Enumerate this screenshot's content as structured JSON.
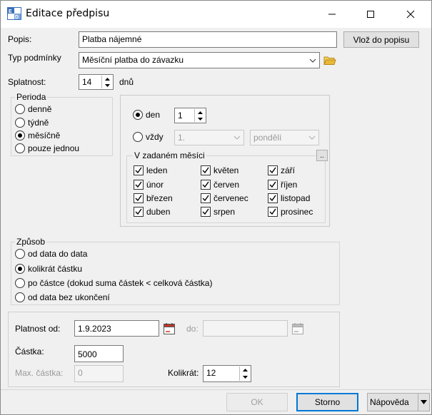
{
  "window": {
    "title": "Editace předpisu",
    "icon": "app-document-icon"
  },
  "popis": {
    "label": "Popis:",
    "value": "Platba nájemné",
    "button": "Vlož do popisu"
  },
  "typ": {
    "label": "Typ podmínky",
    "value": "Měsíční platba do závazku"
  },
  "splatnost": {
    "label": "Splatnost:",
    "value": "14",
    "unit": "dnů"
  },
  "perioda": {
    "title": "Perioda",
    "options": [
      "denně",
      "týdně",
      "měsíčně",
      "pouze jednou"
    ],
    "selected": "měsíčně"
  },
  "den_panel": {
    "den_label": "den",
    "den_value": "1",
    "vzdy_label": "vždy",
    "vzdy_value": "1.",
    "weekday_value": "pondělí",
    "selected": "den"
  },
  "months": {
    "title": "V zadaném měsíci",
    "more_button": "..",
    "items": [
      "leden",
      "únor",
      "březen",
      "duben",
      "květen",
      "červen",
      "červenec",
      "srpen",
      "září",
      "říjen",
      "listopad",
      "prosinec"
    ]
  },
  "zpusob": {
    "title": "Způsob",
    "options": [
      "od data do data",
      "kolikrát částku",
      "po částce (dokud suma částek < celková částka)",
      "od data bez ukončení"
    ],
    "selected": "kolikrát částku"
  },
  "bottom": {
    "platnost_label": "Platnost od:",
    "platnost_value": "1.9.2023",
    "do_label": "do:",
    "do_value": "",
    "castka_label": "Částka:",
    "castka_value": "5000",
    "max_label": "Max. částka:",
    "max_value": "0",
    "kolikrat_label": "Kolikrát:",
    "kolikrat_value": "12"
  },
  "footer": {
    "ok": "OK",
    "storno": "Storno",
    "napoveda": "Nápověda"
  },
  "colors": {
    "accent": "#0078d7",
    "folder": "#e8b83a"
  }
}
